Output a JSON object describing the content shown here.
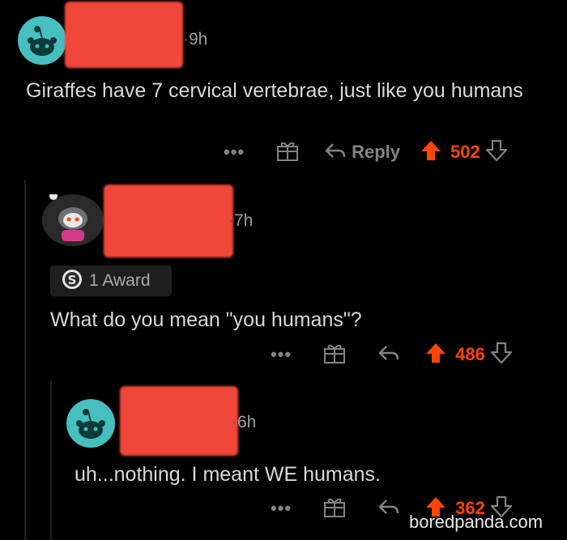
{
  "comments": [
    {
      "time": "9h",
      "body": "Giraffes have 7 cervical vertebrae, just like you humans",
      "reply_label": "Reply",
      "score": "502"
    },
    {
      "time": "7h",
      "award_label": "1 Award",
      "body": "What do you mean \"you humans\"?",
      "score": "486"
    },
    {
      "time": "6h",
      "body": "uh...nothing. I meant WE humans.",
      "score": "362"
    }
  ],
  "more_label": "•••",
  "watermark": "boredpanda.com",
  "colors": {
    "background": "#000000",
    "upvote": "#ff4500",
    "redaction": "#f0473a",
    "avatar_teal": "#46bfbf",
    "muted": "#818384"
  },
  "icons": [
    "snoo-avatar-icon",
    "gift-icon",
    "reply-arrow-icon",
    "upvote-arrow-icon",
    "downvote-arrow-icon",
    "silver-award-icon"
  ]
}
